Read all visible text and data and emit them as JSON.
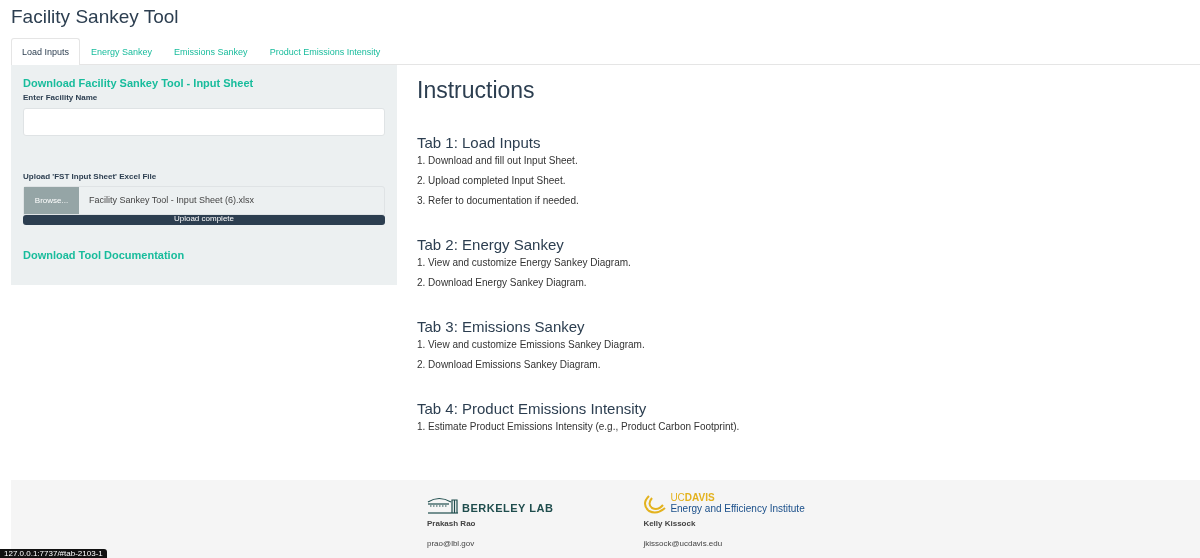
{
  "title": "Facility Sankey Tool",
  "tabs": [
    {
      "label": "Load Inputs",
      "selected": true
    },
    {
      "label": "Energy Sankey",
      "selected": false
    },
    {
      "label": "Emissions Sankey",
      "selected": false
    },
    {
      "label": "Product Emissions Intensity",
      "selected": false
    }
  ],
  "sidebar": {
    "download_link": "Download Facility Sankey Tool - Input Sheet",
    "name_label": "Enter Facility Name",
    "upload_label": "Upload 'FST Input Sheet' Excel File",
    "browse_button": "Browse...",
    "file_name": "Facility Sankey Tool - Input Sheet (6).xlsx",
    "progress": {
      "level": 1,
      "text": "Upload complete"
    },
    "doc_link": "Download Tool Documentation"
  },
  "instructions": {
    "title": "Instructions",
    "sections": [
      {
        "heading": "Tab 1: Load Inputs",
        "steps": [
          "1. Download and fill out Input Sheet.",
          "2. Upload completed Input Sheet.",
          "3. Refer to documentation if needed."
        ]
      },
      {
        "heading": "Tab 2: Energy Sankey",
        "steps": [
          "1. View and customize Energy Sankey Diagram.",
          "2. Download Energy Sankey Diagram."
        ]
      },
      {
        "heading": "Tab 3: Emissions Sankey",
        "steps": [
          "1. View and customize Emissions Sankey Diagram.",
          "2. Download Emissions Sankey Diagram."
        ]
      },
      {
        "heading": "Tab 4: Product Emissions Intensity",
        "steps": [
          "1. Estimate Product Emissions Intensity (e.g., Product Carbon Footprint)."
        ]
      }
    ]
  },
  "footer": {
    "contacts": [
      {
        "kind": "berkeley",
        "logo_text": "BERKELEY LAB",
        "name": "Prakash Rao",
        "email": "prao@lbl.gov"
      },
      {
        "kind": "davis",
        "logo_text": "UC**DAVIS**",
        "logo_sub": "Energy and Efficiency Institute",
        "name": "Kelly Kissock",
        "email": "jkissock@ucdavis.edu"
      }
    ]
  },
  "status_url": "127.0.0.1:7737/#tab-2103-1"
}
